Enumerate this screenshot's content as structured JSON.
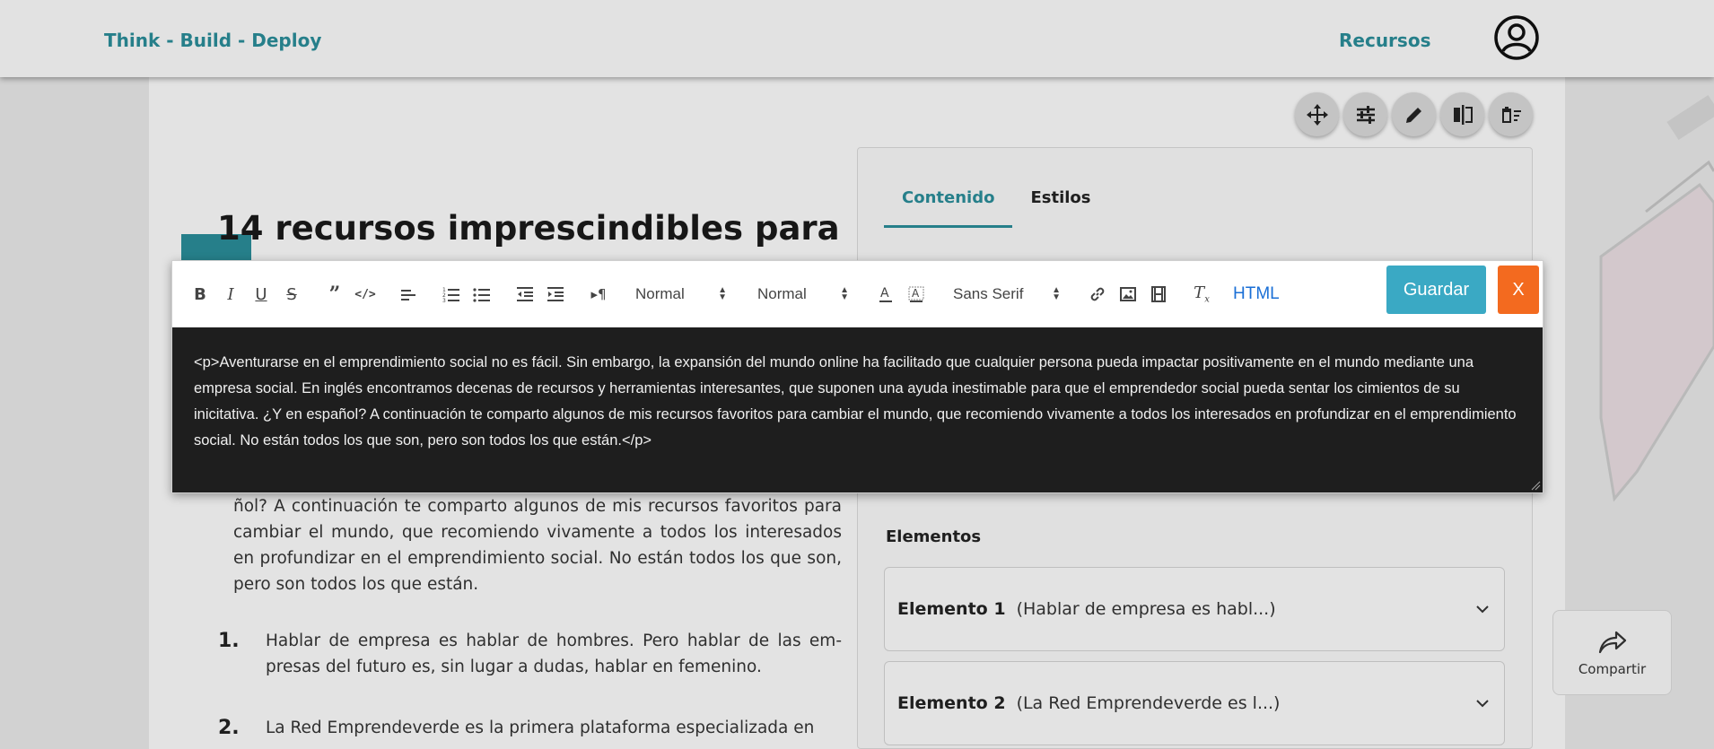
{
  "header": {
    "brand": "Think - Build - Deploy",
    "nav_link": "Recursos"
  },
  "article": {
    "title": "14 recursos imprescindibles para",
    "paragraph_tail": "ñol? A continuación te comparto algunos de mis recursos favoritos para cambiar el mundo, que recomiendo vivamente a todos los interesados en profundizar en el emprendimiento social. No están todos los que son, pero son todos los que están.",
    "list": [
      {
        "num": "1.",
        "text": "Hablar de empresa es hablar de hombres. Pero hablar de las em-presas del futuro es, sin lugar a dudas, hablar en femenino."
      },
      {
        "num": "2.",
        "text": "La Red Emprendeverde es la primera plataforma especializada en"
      }
    ]
  },
  "panel": {
    "tabs": [
      "Contenido",
      "Estilos"
    ],
    "section_label": "Elementos",
    "elements": [
      {
        "title": "Elemento 1",
        "summary": "(Hablar de empresa es habl...)"
      },
      {
        "title": "Elemento 2",
        "summary": "(La Red Emprendeverde es l...)"
      }
    ]
  },
  "share": {
    "label": "Compartir"
  },
  "editor": {
    "selects": {
      "header": "Normal",
      "size": "Normal",
      "font": "Sans Serif"
    },
    "html_toggle": "HTML",
    "save_label": "Guardar",
    "close_label": "X",
    "content": "<p>Aventurarse en el emprendimiento social no es fácil. Sin embargo, la expansión del mundo online ha facilitado que cualquier persona pueda impactar positivamente en el mundo mediante una empresa social. En inglés encontramos decenas de recursos y herramientas interesantes, que suponen una ayuda inestimable para que el emprendedor social pueda sentar los cimientos de su inicitativa. ¿Y en español? A continuación te comparto algunos de mis recursos favoritos para cambiar el mundo, que recomiendo vivamente a todos los interesados en profundizar en el emprendimiento social. No están todos los que son, pero son todos los que están.</p>"
  },
  "colors": {
    "accent": "#2a8a96",
    "save": "#3aa9c4",
    "close": "#f36a1f",
    "code_bg": "#1e1e1e"
  }
}
